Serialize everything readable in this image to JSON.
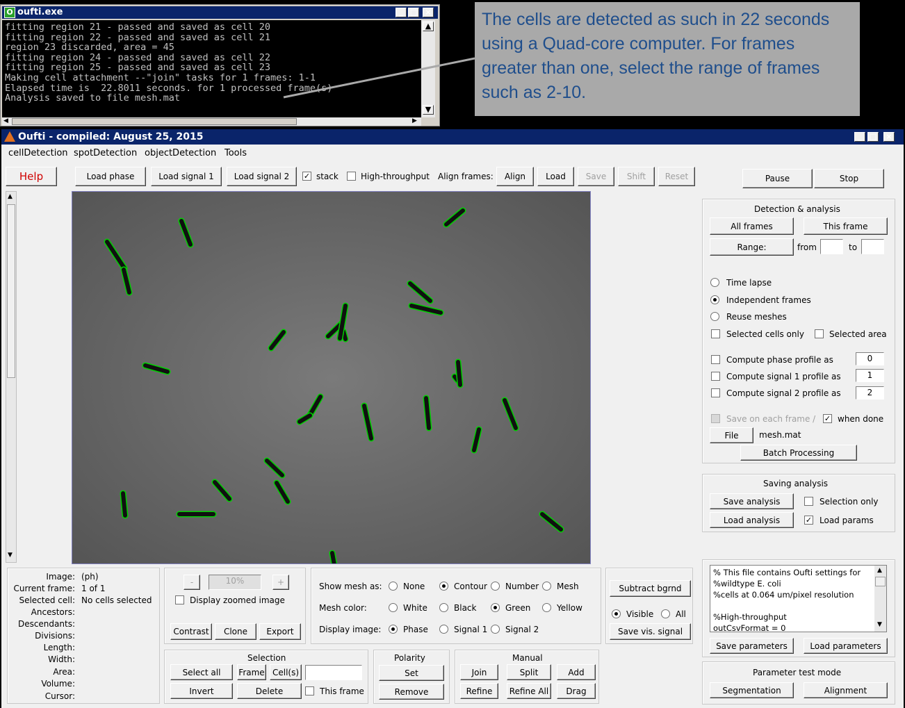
{
  "console": {
    "title": "oufti.exe",
    "lines": [
      "fitting region 21 - passed and saved as cell 20",
      "fitting region 22 - passed and saved as cell 21",
      "region 23 discarded, area = 45",
      "fitting region 24 - passed and saved as cell 22",
      "fitting region 25 - passed and saved as cell 23",
      "Making cell attachment --\"join\" tasks for 1 frames: 1-1",
      "Elapsed time is  22.8011 seconds. for 1 processed frame(s)",
      "Analysis saved to file mesh.mat"
    ]
  },
  "callout": "The cells are detected as such in 22 seconds using a Quad-core computer.   For frames greater than one,  select the range of frames such as 2-10.",
  "window": {
    "title": "Oufti - compiled:  August 25, 2015",
    "menu": [
      "cellDetection",
      "spotDetection",
      "objectDetection",
      "Tools"
    ]
  },
  "toolbar": {
    "help": "Help",
    "load_phase": "Load phase",
    "load_signal1": "Load signal 1",
    "load_signal2": "Load signal 2",
    "stack": "stack",
    "high_throughput": "High-throughput",
    "align_frames": "Align frames:",
    "align": "Align",
    "load": "Load",
    "save": "Save",
    "shift": "Shift",
    "reset": "Reset",
    "pause": "Pause",
    "stop": "Stop"
  },
  "detection": {
    "title": "Detection & analysis",
    "all_frames": "All frames",
    "this_frame": "This frame",
    "range": "Range:",
    "from": "from",
    "to": "to",
    "time_lapse": "Time lapse",
    "independent": "Independent frames",
    "reuse": "Reuse meshes",
    "selected_cells": "Selected cells only",
    "selected_area": "Selected area",
    "phase_profile": "Compute phase profile as",
    "sig1_profile": "Compute signal 1 profile as",
    "sig2_profile": "Compute signal 2 profile as",
    "phase_val": "0",
    "sig1_val": "1",
    "sig2_val": "2",
    "save_each": "Save on each frame /",
    "when_done": "when done",
    "file": "File",
    "filename": "mesh.mat",
    "batch": "Batch Processing"
  },
  "saving": {
    "title": "Saving analysis",
    "save_analysis": "Save analysis",
    "selection_only": "Selection only",
    "load_analysis": "Load analysis",
    "load_params": "Load params"
  },
  "params": {
    "text": "% This file contains Oufti settings for\n%wildtype E. coli\n%cells at 0.064 um/pixel resolution\n\n%High-throughput\noutCsvFormat = 0",
    "save": "Save parameters",
    "load": "Load parameters",
    "test_mode": "Parameter test mode",
    "segmentation": "Segmentation",
    "alignment": "Alignment"
  },
  "info": {
    "image_label": "Image:",
    "image_val": "(ph)",
    "frame_label": "Current frame:",
    "frame_val": "1 of 1",
    "cell_label": "Selected cell:",
    "cell_val": "No cells selected",
    "ancestors": "Ancestors:",
    "descendants": "Descendants:",
    "divisions": "Divisions:",
    "length": "Length:",
    "width": "Width:",
    "area": "Area:",
    "volume": "Volume:",
    "cursor": "Cursor:"
  },
  "zoom": {
    "minus": "-",
    "value": "10%",
    "plus": "+",
    "display_zoomed": "Display zoomed image",
    "contrast": "Contrast",
    "clone": "Clone",
    "export": "Export"
  },
  "display": {
    "show_mesh": "Show mesh as:",
    "none": "None",
    "contour": "Contour",
    "number": "Number",
    "mesh": "Mesh",
    "mesh_color": "Mesh color:",
    "white": "White",
    "black": "Black",
    "green": "Green",
    "yellow": "Yellow",
    "display_image": "Display image:",
    "phase": "Phase",
    "signal1": "Signal 1",
    "signal2": "Signal 2"
  },
  "bg": {
    "subtract": "Subtract bgrnd",
    "visible": "Visible",
    "all": "All",
    "save_vis": "Save vis. signal"
  },
  "selection": {
    "title": "Selection",
    "select_all": "Select all",
    "frame": "Frame",
    "cells": "Cell(s)",
    "invert": "Invert",
    "delete": "Delete",
    "this_frame": "This frame"
  },
  "polarity": {
    "title": "Polarity",
    "set": "Set",
    "remove": "Remove"
  },
  "manual": {
    "title": "Manual",
    "join": "Join",
    "split": "Split",
    "add": "Add",
    "refine": "Refine",
    "refine_all": "Refine All",
    "drag": "Drag"
  },
  "colors": {
    "console_bg": "#000000",
    "callout_bg": "#a9a9a9",
    "callout_text": "#1f4e8c",
    "titlebar": "#0a246a",
    "cell_outline": "#00d000",
    "help_text": "#d00000"
  }
}
